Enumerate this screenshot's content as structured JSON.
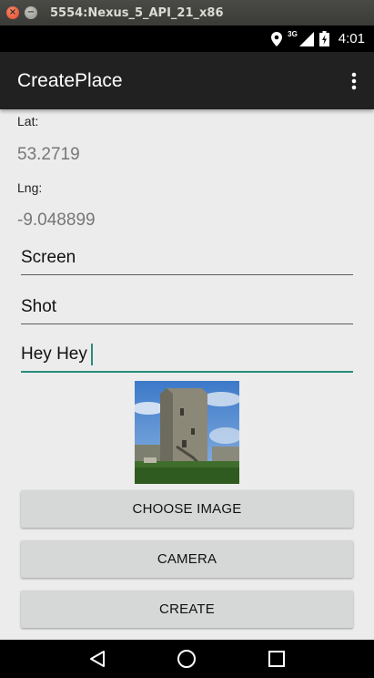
{
  "window": {
    "title": "5554:Nexus_5_API_21_x86",
    "close_glyph": "×",
    "minimize_glyph": "−"
  },
  "status_bar": {
    "network_type": "3G",
    "time": "4:01",
    "icons": [
      "location-icon",
      "signal-icon",
      "battery-icon"
    ]
  },
  "app_bar": {
    "title": "CreatePlace",
    "overflow_icon": "more-vert-icon"
  },
  "location": {
    "lat_label": "Lat:",
    "lat_value": "53.2719",
    "lng_label": "Lng:",
    "lng_value": "-9.048899"
  },
  "fields": {
    "field1_value": "Screen",
    "field2_value": "Shot",
    "field3_value": "Hey Hey"
  },
  "image": {
    "icon": "castle-photo"
  },
  "buttons": {
    "choose_image": "CHOOSE IMAGE",
    "camera": "CAMERA",
    "create": "CREATE"
  },
  "nav_bar": {
    "icons": [
      "back-icon",
      "home-icon",
      "recents-icon"
    ]
  },
  "colors": {
    "app_bar": "#212121",
    "accent": "#2a8c7e",
    "button": "#d6d7d7",
    "background": "#ececec"
  }
}
